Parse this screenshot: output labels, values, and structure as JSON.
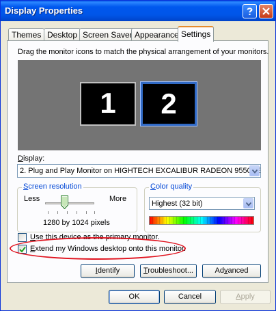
{
  "window": {
    "title": "Display Properties"
  },
  "tabs": [
    {
      "label": "Themes"
    },
    {
      "label": "Desktop"
    },
    {
      "label": "Screen Saver"
    },
    {
      "label": "Appearance"
    },
    {
      "label": "Settings"
    }
  ],
  "settings": {
    "instruction": "Drag the monitor icons to match the physical arrangement of your monitors.",
    "monitors": [
      {
        "label": "1"
      },
      {
        "label": "2"
      }
    ],
    "display_label": "Display:",
    "display_value": "2. Plug and Play Monitor on HIGHTECH EXCALIBUR RADEON 9550SE",
    "resolution": {
      "title": "Screen resolution",
      "less": "Less",
      "more": "More",
      "value": "1280 by 1024 pixels",
      "slider_position": 0.4
    },
    "color_quality": {
      "title": "Color quality",
      "value": "Highest (32 bit)"
    },
    "primary_checkbox": {
      "label": "Use this device as the primary monitor.",
      "checked": false
    },
    "extend_checkbox": {
      "label": "Extend my Windows desktop onto this monitor.",
      "checked": true
    },
    "buttons": {
      "identify": "Identify",
      "troubleshoot": "Troubleshoot...",
      "advanced": "Advanced"
    }
  },
  "footer": {
    "ok": "OK",
    "cancel": "Cancel",
    "apply": "Apply"
  },
  "colors": {
    "title_bar": "#0058ee",
    "highlight_ellipse": "#e0121e",
    "monitor_area": "#747474"
  }
}
